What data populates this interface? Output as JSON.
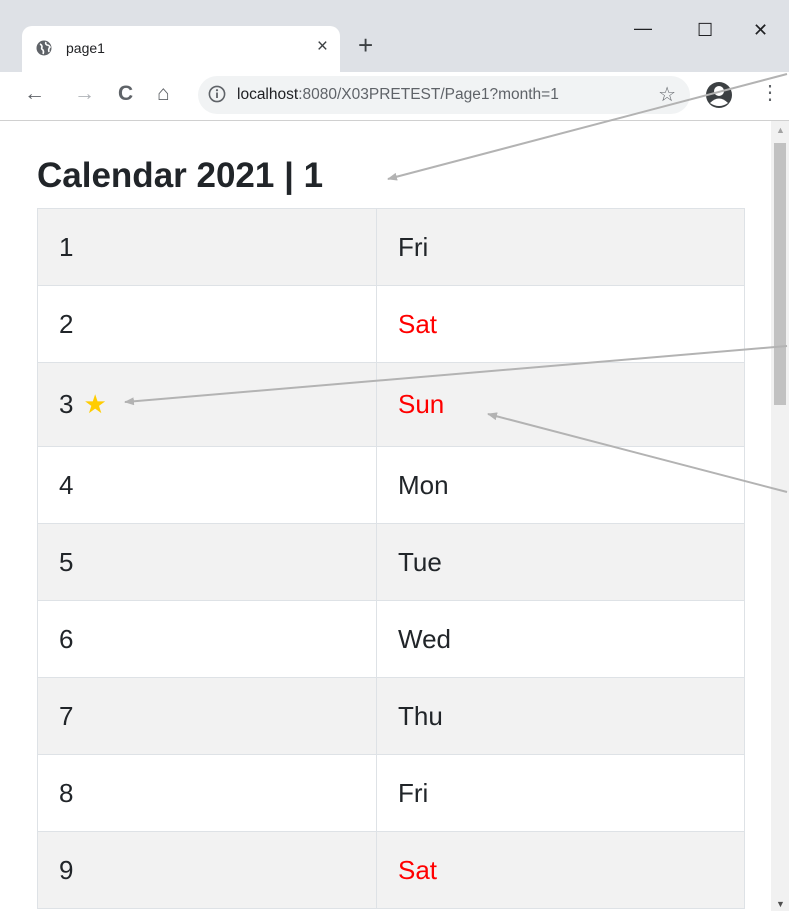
{
  "browser": {
    "tab_title": "page1",
    "tab_close": "×",
    "new_tab": "+",
    "window_controls": {
      "minimize": "—",
      "maximize": "☐",
      "close": "✕"
    },
    "nav": {
      "back": "←",
      "forward": "→",
      "reload": "C",
      "home": "⌂"
    },
    "url_host": "localhost",
    "url_path": ":8080/X03PRETEST/Page1?month=1",
    "bookmark": "☆",
    "menu": "⋮"
  },
  "page": {
    "title": "Calendar 2021 | 1",
    "rows": [
      {
        "day": "1",
        "weekday": "Fri",
        "weekend": false,
        "starred": false
      },
      {
        "day": "2",
        "weekday": "Sat",
        "weekend": true,
        "starred": false
      },
      {
        "day": "3",
        "weekday": "Sun",
        "weekend": true,
        "starred": true
      },
      {
        "day": "4",
        "weekday": "Mon",
        "weekend": false,
        "starred": false
      },
      {
        "day": "5",
        "weekday": "Tue",
        "weekend": false,
        "starred": false
      },
      {
        "day": "6",
        "weekday": "Wed",
        "weekend": false,
        "starred": false
      },
      {
        "day": "7",
        "weekday": "Thu",
        "weekend": false,
        "starred": false
      },
      {
        "day": "8",
        "weekday": "Fri",
        "weekend": false,
        "starred": false
      },
      {
        "day": "9",
        "weekday": "Sat",
        "weekend": true,
        "starred": false
      }
    ],
    "star_glyph": "★"
  },
  "colors": {
    "weekend_text": "#ff0000",
    "star": "#ffcc00",
    "striped_row": "#f2f2f2",
    "annotation_arrow": "#b3b3b3"
  },
  "icons": [
    "globe-icon",
    "info-icon",
    "bookmark-star-icon",
    "profile-icon",
    "menu-icon"
  ]
}
